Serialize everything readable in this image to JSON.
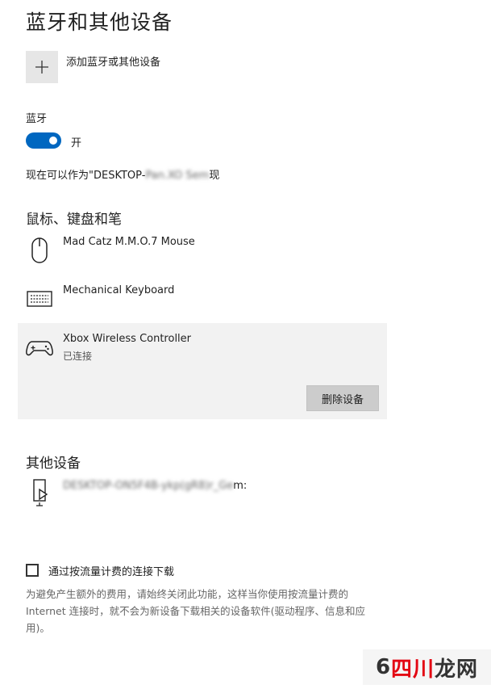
{
  "page": {
    "title": "蓝牙和其他设备",
    "add_device_label": "添加蓝牙或其他设备",
    "bluetooth_label": "蓝牙",
    "bluetooth_state": "开",
    "discoverable_prefix": "现在可以作为\"DESKTOP-",
    "discoverable_suffix": "现"
  },
  "sections": {
    "mouse_keyboard_pen": "鼠标、键盘和笔",
    "other_devices": "其他设备"
  },
  "devices": [
    {
      "name": "Mad Catz M.M.O.7 Mouse",
      "icon": "mouse-icon"
    },
    {
      "name": "Mechanical Keyboard",
      "icon": "keyboard-icon"
    },
    {
      "name": "Xbox Wireless Controller",
      "status": "已连接",
      "icon": "gamepad-icon",
      "action": "删除设备"
    }
  ],
  "other_device": {
    "name_suffix": "m:",
    "icon": "phone-media-icon"
  },
  "metered": {
    "checkbox_label": "通过按流量计费的连接下载",
    "description": "为避免产生额外的费用，请始终关闭此功能，这样当你使用按流量计费的 Internet 连接时，就不会为新设备下载相关的设备软件(驱动程序、信息和应用)。"
  },
  "watermark": {
    "prefix": "6",
    "middle": "四川",
    "suffix": "龙网"
  }
}
